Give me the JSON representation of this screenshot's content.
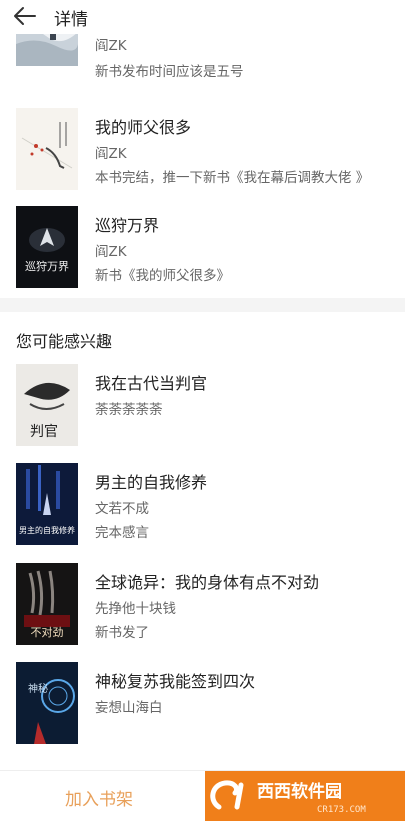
{
  "header": {
    "title": "详情"
  },
  "author_books": [
    {
      "title": "",
      "author": "阎ZK",
      "desc": "新书发布时间应该是五号"
    },
    {
      "title": "我的师父很多",
      "author": "阎ZK",
      "desc": "本书完结，推一下新书《我在幕后调教大佬 》"
    },
    {
      "title": "巡狩万界",
      "author": "阎ZK",
      "desc": "新书《我的师父很多》",
      "cover_text": "巡狩万界"
    }
  ],
  "recommend": {
    "section_title": "您可能感兴趣",
    "books": [
      {
        "title": "我在古代当判官",
        "author": "荼荼荼荼荼",
        "desc": "",
        "cover_text": "判官"
      },
      {
        "title": "男主的自我修养",
        "author": "文若不成",
        "desc": "完本感言",
        "cover_text": "男主的自我修养"
      },
      {
        "title": "全球诡异：我的身体有点不对劲",
        "author": "先挣他十块钱",
        "desc": "新书发了",
        "cover_text": "不对劲"
      },
      {
        "title": "神秘复苏我能签到四次",
        "author": "妄想山海白",
        "desc": "",
        "cover_text": "神秘"
      }
    ]
  },
  "bottom": {
    "add_shelf": "加入书架"
  },
  "watermark": {
    "main": "西西软件园",
    "sub": "CR173.COM"
  }
}
